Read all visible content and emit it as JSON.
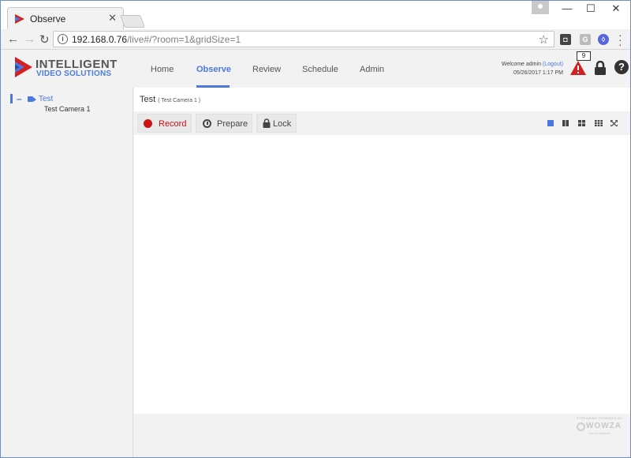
{
  "browser": {
    "tab_title": "Observe",
    "tab_close": "✕",
    "url_host": "192.168.0.76",
    "url_rest": "/live#/?room=1&gridSize=1",
    "window_buttons": [
      "—",
      "☐",
      "✕"
    ]
  },
  "app": {
    "logo_line1": "INTELLIGENT",
    "logo_line2": "VIDEO SOLUTIONS",
    "nav": [
      "Home",
      "Observe",
      "Review",
      "Schedule",
      "Admin"
    ],
    "active_nav": "Observe",
    "welcome_prefix": "Welcome admin ",
    "logout": "(Logout)",
    "datetime": "05/26/2017 1:17 PM",
    "alert_count": "9",
    "help": "?"
  },
  "sidebar": {
    "rooms": [
      {
        "label": "Test",
        "cameras": [
          "Test Camera 1"
        ]
      }
    ]
  },
  "main": {
    "room_title": "Test",
    "room_subtitle": "( Test Camera 1 )",
    "controls": {
      "record": "Record",
      "prepare": "Prepare",
      "lock": "Lock"
    }
  },
  "footer": {
    "powered_by": "STREAMING POWERED BY",
    "brand": "WOWZA",
    "tagline": "media systems"
  },
  "colors": {
    "accent": "#4a78e0",
    "record_red": "#cc1616",
    "alert_red": "#d32020"
  }
}
